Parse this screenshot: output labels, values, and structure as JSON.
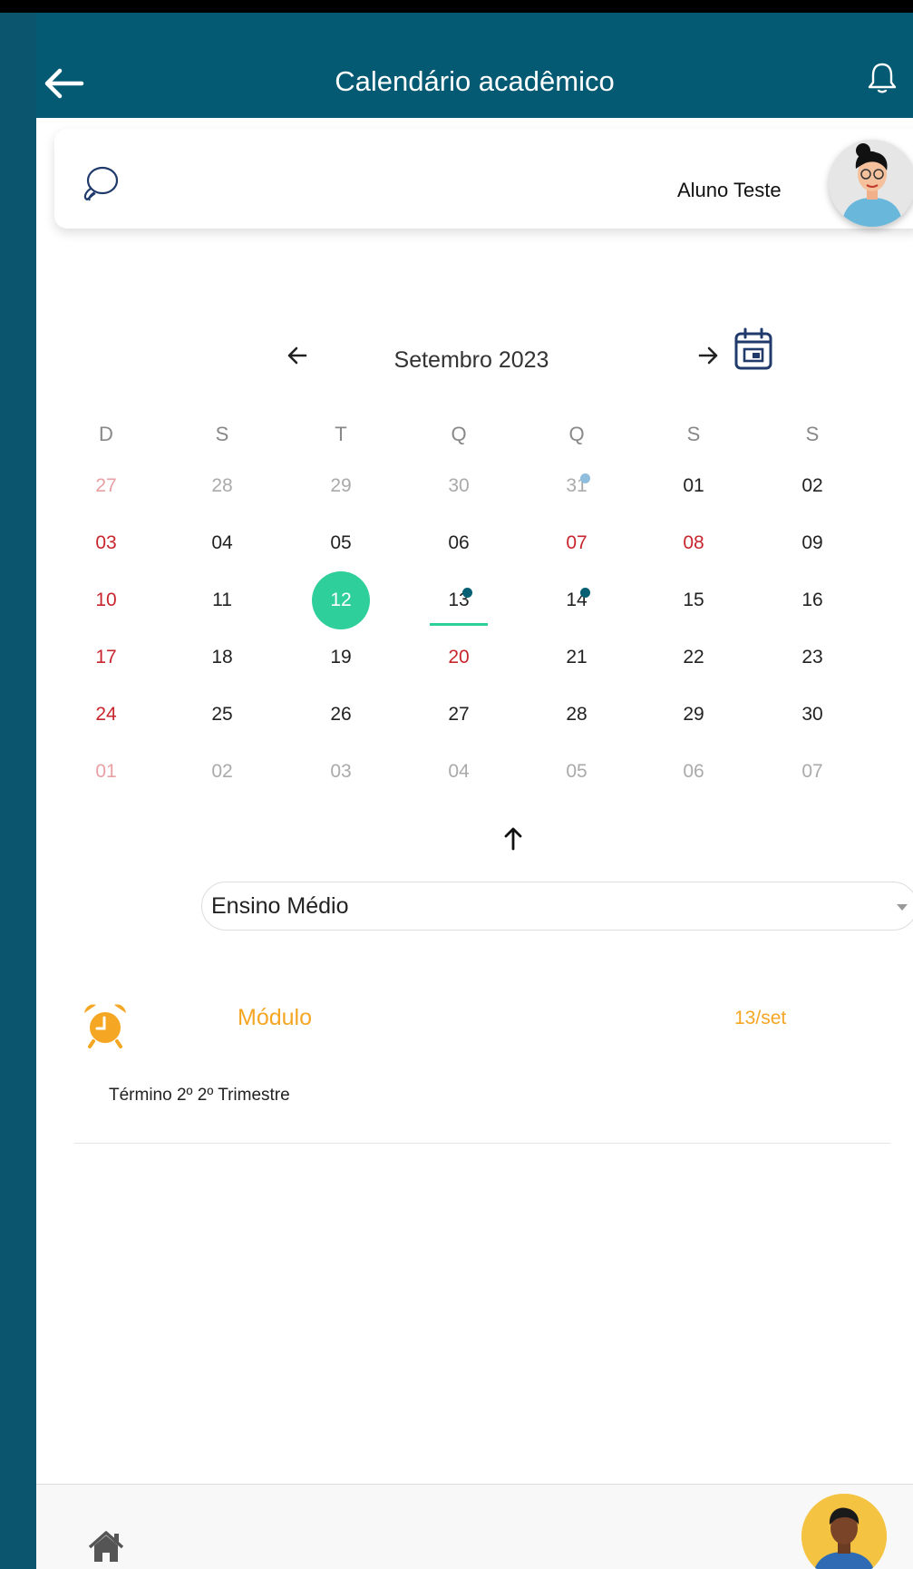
{
  "header": {
    "title": "Calendário acadêmico",
    "back_icon": "arrow-left-icon",
    "bell_icon": "bell-icon",
    "color": "#045a72"
  },
  "profile": {
    "name": "Aluno Teste",
    "chat_icon": "chat-bubbles-icon"
  },
  "calendar": {
    "month_label": "Setembro 2023",
    "weekdays": [
      "D",
      "S",
      "T",
      "Q",
      "Q",
      "S",
      "S"
    ],
    "weeks": [
      [
        "27",
        "28",
        "29",
        "30",
        "31",
        "01",
        "02"
      ],
      [
        "03",
        "04",
        "05",
        "06",
        "07",
        "08",
        "09"
      ],
      [
        "10",
        "11",
        "12",
        "13",
        "14",
        "15",
        "16"
      ],
      [
        "17",
        "18",
        "19",
        "20",
        "21",
        "22",
        "23"
      ],
      [
        "24",
        "25",
        "26",
        "27",
        "28",
        "29",
        "30"
      ],
      [
        "01",
        "02",
        "03",
        "04",
        "05",
        "06",
        "07"
      ]
    ],
    "selected_day": "12",
    "accent_color": "#2fcf9b",
    "holiday_color": "#c8262e"
  },
  "filter": {
    "selected": "Ensino Médio"
  },
  "events": [
    {
      "type": "Módulo",
      "date": "13/set",
      "description": "Término 2º 2º Trimestre",
      "icon": "alarm-clock-icon",
      "color": "#f5a623"
    }
  ],
  "bottom_nav": {
    "home_icon": "home-icon"
  }
}
